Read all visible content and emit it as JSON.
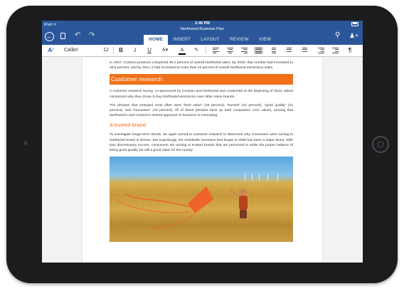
{
  "device": {
    "status_bar": {
      "carrier": "iPad ᯤ",
      "time": "2:46 PM"
    }
  },
  "app": {
    "document_title": "Northwind Business Plan",
    "tabs": [
      {
        "label": "HOME",
        "active": true
      },
      {
        "label": "INSERT",
        "active": false
      },
      {
        "label": "LAYOUT",
        "active": false
      },
      {
        "label": "REVIEW",
        "active": false
      },
      {
        "label": "VIEW",
        "active": false
      }
    ],
    "accent_color": "#2b579a"
  },
  "toolbar": {
    "font_name": "Calibri",
    "font_size": "12",
    "bold_label": "B",
    "italic_label": "I",
    "underline_label": "U",
    "font_size_adjust_label": "A",
    "font_color_label": "A",
    "paragraph_mark_label": "¶",
    "active_alignment": "justify"
  },
  "document": {
    "intro_paragraph": "In 2007, Contoso products comprised 35.2 percent of overall Northwind sales. By 2009, that number had increased to 39.8 percent, and by 2011, it had increased to more than 42 percent of overall Northwind electronics sales.",
    "heading_1": "Customer research",
    "heading_1_color": "#f0711a",
    "paragraph_2": "A customer research survey, co-sponsored by Contoso and Northwind and conducted at the beginning of 2013, asked consumers why they chose to buy Northwind electronics over other name brands.",
    "paragraph_3": "The phrases that emerged most often were “best value” (26 percent), “trusted” (23 percent), “good quality” (21 percent), and “innovative” (19 percent). All of these phrases back up both companies’ core values, proving that Northwind’s and Contoso’s shared approach to business is resonating.",
    "heading_2": "A trusted brand",
    "paragraph_4": "To investigate longer-term trends, we again turned to customer research to determine why consumers were turning to Northwind brand in droves. Not surprisingly, the worldwide recession that began in 2008 has been a major factor. With less discretionary income, consumers are turning to trusted brands that are perceived to strike the proper balance of being good quality yet still a good value for the money."
  }
}
